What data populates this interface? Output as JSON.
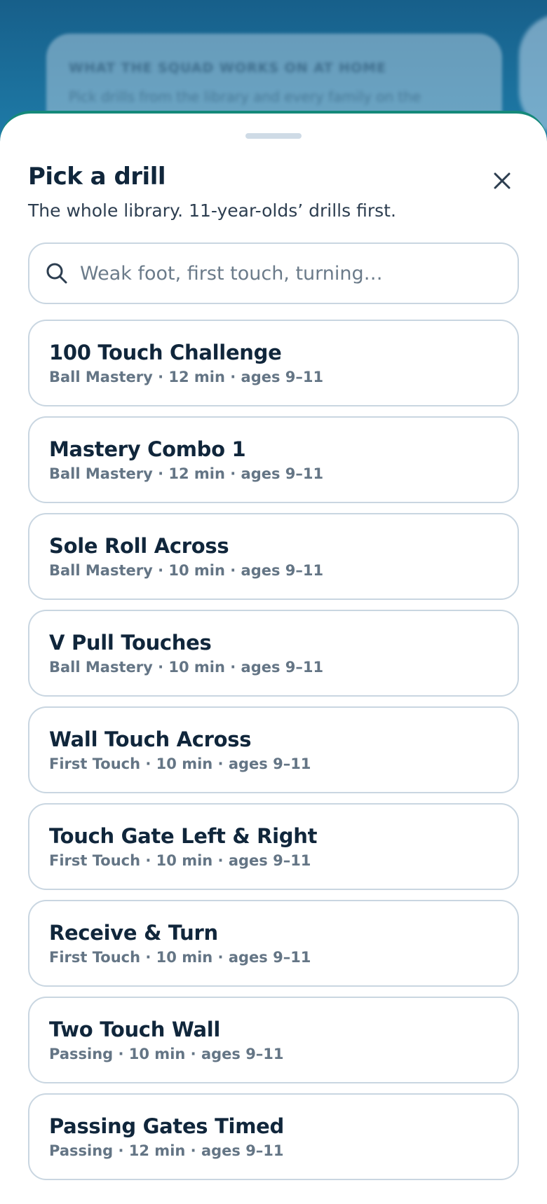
{
  "backdrop": {
    "eyebrow": "WHAT THE SQUAD WORKS ON AT HOME",
    "subline": "Pick drills from the library and every family on the"
  },
  "sheet": {
    "title": "Pick a drill",
    "subtitle": "The whole library. 11-year-olds’ drills first.",
    "close_icon": "close-icon"
  },
  "search": {
    "value": "",
    "placeholder": "Weak foot, first touch, turning…",
    "icon": "search-icon"
  },
  "drills": [
    {
      "name": "100 Touch Challenge",
      "meta": "Ball Mastery · 12 min · ages 9–11"
    },
    {
      "name": "Mastery Combo 1",
      "meta": "Ball Mastery · 12 min · ages 9–11"
    },
    {
      "name": "Sole Roll Across",
      "meta": "Ball Mastery · 10 min · ages 9–11"
    },
    {
      "name": "V Pull Touches",
      "meta": "Ball Mastery · 10 min · ages 9–11"
    },
    {
      "name": "Wall Touch Across",
      "meta": "First Touch · 10 min · ages 9–11"
    },
    {
      "name": "Touch Gate Left & Right",
      "meta": "First Touch · 10 min · ages 9–11"
    },
    {
      "name": "Receive & Turn",
      "meta": "First Touch · 10 min · ages 9–11"
    },
    {
      "name": "Two Touch Wall",
      "meta": "Passing · 10 min · ages 9–11"
    },
    {
      "name": "Passing Gates Timed",
      "meta": "Passing · 12 min · ages 9–11"
    }
  ],
  "colors": {
    "accent": "#15897a",
    "text_primary": "#10263b",
    "text_secondary": "#647585",
    "border": "#c9d6e1"
  }
}
